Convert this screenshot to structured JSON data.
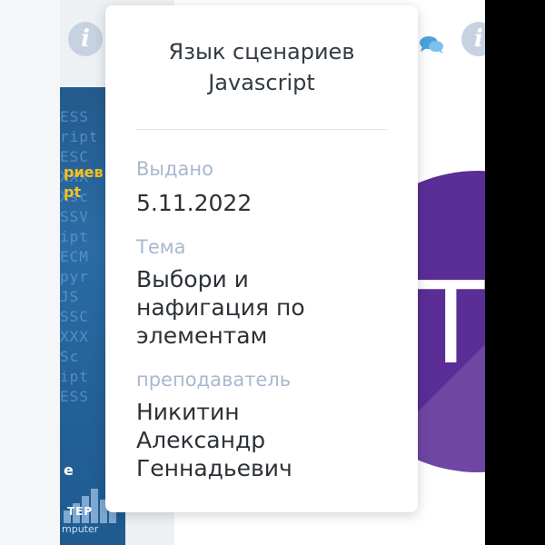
{
  "popover": {
    "title_line1": "Язык сценариев",
    "title_line2": "Javascript",
    "issued_label": "Выдано",
    "issued_value": "5.11.2022",
    "topic_label": "Тема",
    "topic_value_line1": "Выбори и",
    "topic_value_line2": "нафигация по",
    "topic_value_line3": "элементам",
    "teacher_label": "преподаватель",
    "teacher_value_line1": "Никитин",
    "teacher_value_line2": "Александр",
    "teacher_value_line3": "Геннадьевич"
  },
  "background": {
    "info_icon_glyph": "i",
    "book_cover_line1": "риев",
    "book_cover_line2": "pt",
    "book_cover_line3": "e",
    "book_cover_logo": "TEP",
    "book_cover_sub": "mputer",
    "purple_letter": "T"
  },
  "colors": {
    "purple": "#5b2d97",
    "info_icon": "#c7d2e1",
    "label": "#a9b8d0",
    "text": "#2c3136"
  },
  "icons": [
    "info-icon",
    "chat-icon"
  ]
}
